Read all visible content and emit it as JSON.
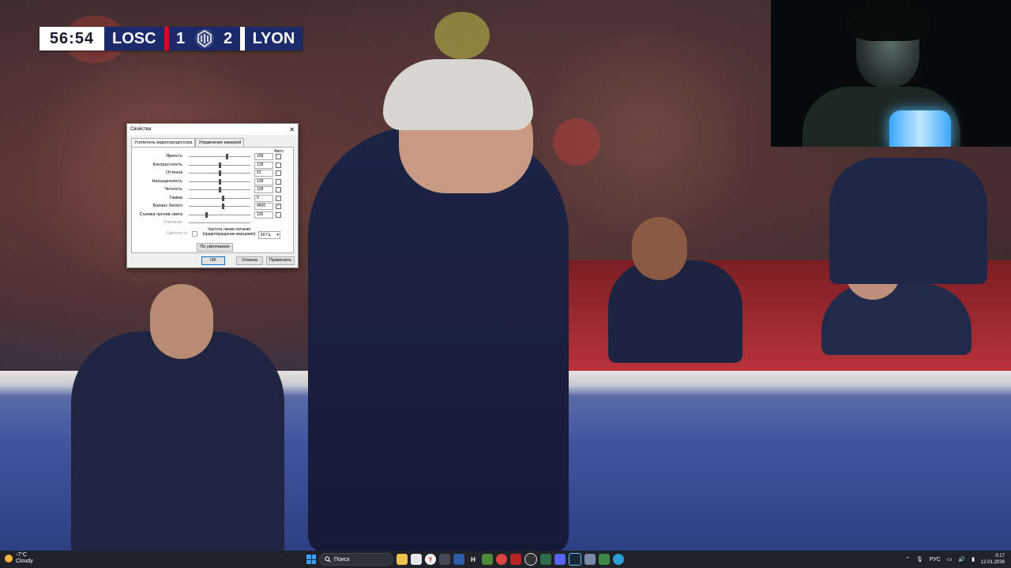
{
  "scoreboard": {
    "time": "56:54",
    "home_team": "LOSC",
    "home_score": "1",
    "away_score": "2",
    "away_team": "LYON",
    "home_color": "#e2001a",
    "away_color": "#ffffff",
    "bar_color": "#1b2a6b"
  },
  "dialog": {
    "title": "Свойства",
    "tabs": [
      "Усилитель видеопроцессора",
      "Управление камерой"
    ],
    "auto_header": "Авто",
    "controls": [
      {
        "label": "Яркость",
        "value": "158",
        "auto": false,
        "level": 0.62
      },
      {
        "label": "Контрастность",
        "value": "128",
        "auto": false,
        "level": 0.5
      },
      {
        "label": "Оттенок",
        "value": "63",
        "auto": false,
        "level": 0.5
      },
      {
        "label": "Насыщенность",
        "value": "128",
        "auto": false,
        "level": 0.5
      },
      {
        "label": "Четкость",
        "value": "128",
        "auto": false,
        "level": 0.5
      },
      {
        "label": "Гамма",
        "value": "5",
        "auto": false,
        "level": 0.55
      },
      {
        "label": "Баланс белого",
        "value": "4650",
        "auto": true,
        "level": 0.55
      },
      {
        "label": "Съемка против света",
        "value": "100",
        "auto": false,
        "level": 0.28
      },
      {
        "label": "Усиление",
        "value": "",
        "auto": false,
        "level": 0.0,
        "disabled": true
      }
    ],
    "color_label": "Цветность",
    "freq_label": "Частота линии питания (предотвращение мерцания)",
    "freq_value": "50 Гц",
    "default_button": "По умолчанию",
    "ok_button": "OK",
    "cancel_button": "Отмена",
    "apply_button": "Применить"
  },
  "taskbar": {
    "weather_temp": "-7°C",
    "weather_desc": "Cloudy",
    "search_placeholder": "Поиск",
    "language": "РУС",
    "time": "0:17",
    "date": "12.01.2026",
    "icons": [
      "start-icon",
      "file-explorer-icon",
      "notes-icon",
      "yandex-browser-icon",
      "store-icon",
      "app-icon",
      "h-app-icon",
      "minecraft-icon",
      "chrome-icon",
      "shield-icon",
      "obs-icon",
      "terminal-icon",
      "discord-icon",
      "steam-icon",
      "settings-icon",
      "game-icon",
      "edge-icon"
    ]
  }
}
